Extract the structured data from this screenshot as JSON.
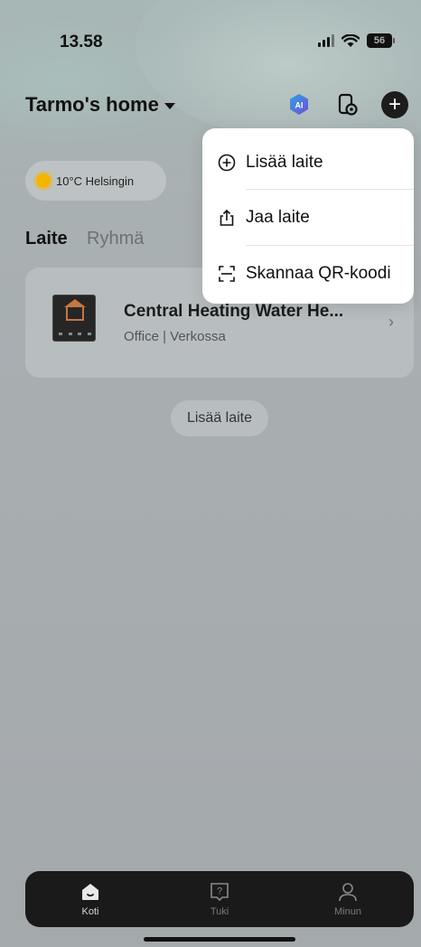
{
  "status_bar": {
    "time": "13.58",
    "battery": "56"
  },
  "header": {
    "home_title": "Tarmo's home",
    "ai_label": "AI"
  },
  "weather": {
    "text": "10°C Helsingin"
  },
  "tabs": [
    {
      "label": "Laite",
      "active": true
    },
    {
      "label": "Ryhmä",
      "active": false
    }
  ],
  "device": {
    "name": "Central Heating Water He...",
    "status": "Office | Verkossa"
  },
  "add_device_button": {
    "label": "Lisää laite"
  },
  "dropdown_menu": {
    "items": [
      {
        "label": "Lisää laite",
        "icon": "plus-circle-icon"
      },
      {
        "label": "Jaa laite",
        "icon": "share-icon"
      },
      {
        "label": "Skannaa QR-koodi",
        "icon": "scan-icon"
      }
    ]
  },
  "bottom_nav": {
    "items": [
      {
        "label": "Koti",
        "icon": "home-icon",
        "active": true
      },
      {
        "label": "Tuki",
        "icon": "help-icon",
        "active": false
      },
      {
        "label": "Minun",
        "icon": "profile-icon",
        "active": false
      }
    ]
  },
  "colors": {
    "accent": "#1c1c1c",
    "ai_badge": "#3a7bd5",
    "sun": "#f5b400"
  }
}
